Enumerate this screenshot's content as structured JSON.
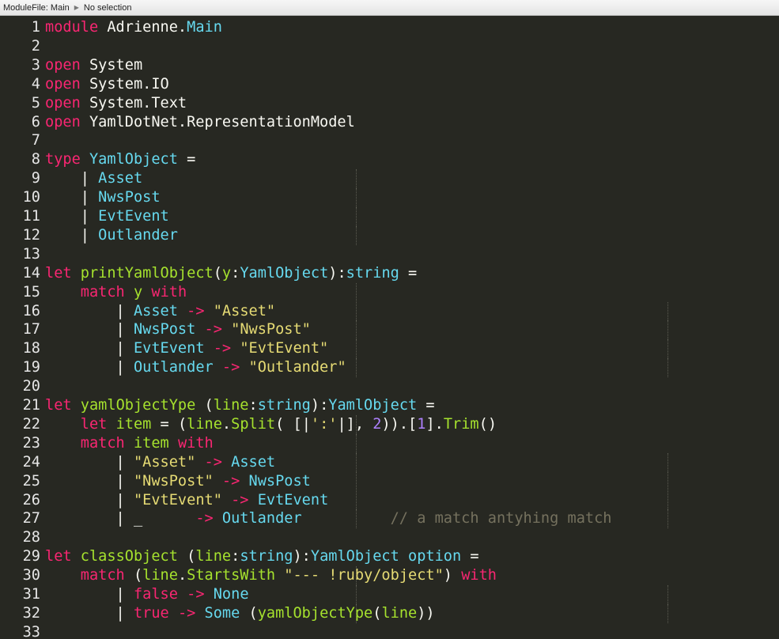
{
  "breadcrumb": {
    "module_file": "ModuleFile: Main",
    "separator": "▶",
    "selection": "No selection"
  },
  "theme": {
    "background": "#272822",
    "keyword": "#f92672",
    "type": "#66d9ef",
    "function": "#a6e22e",
    "string": "#e6db74",
    "number": "#ae81ff",
    "comment": "#75715e",
    "plain": "#f8f8f2"
  },
  "editor": {
    "lines": [
      {
        "num": "1",
        "tokens": [
          [
            "kw",
            "module"
          ],
          [
            "pl",
            " Adrienne."
          ],
          [
            "ty",
            "Main"
          ]
        ]
      },
      {
        "num": "2",
        "tokens": []
      },
      {
        "num": "3",
        "tokens": [
          [
            "kw",
            "open"
          ],
          [
            "pl",
            " System"
          ]
        ]
      },
      {
        "num": "4",
        "tokens": [
          [
            "kw",
            "open"
          ],
          [
            "pl",
            " System.IO"
          ]
        ]
      },
      {
        "num": "5",
        "tokens": [
          [
            "kw",
            "open"
          ],
          [
            "pl",
            " System.Text"
          ]
        ]
      },
      {
        "num": "6",
        "tokens": [
          [
            "kw",
            "open"
          ],
          [
            "pl",
            " YamlDotNet.RepresentationModel"
          ]
        ]
      },
      {
        "num": "7",
        "tokens": []
      },
      {
        "num": "8",
        "tokens": [
          [
            "kw",
            "type"
          ],
          [
            "pl",
            " "
          ],
          [
            "ty",
            "YamlObject"
          ],
          [
            "pl",
            " ="
          ]
        ]
      },
      {
        "num": "9",
        "tokens": [
          [
            "pl",
            "    | "
          ],
          [
            "ty",
            "Asset"
          ]
        ]
      },
      {
        "num": "10",
        "tokens": [
          [
            "pl",
            "    | "
          ],
          [
            "ty",
            "NwsPost"
          ]
        ]
      },
      {
        "num": "11",
        "tokens": [
          [
            "pl",
            "    | "
          ],
          [
            "ty",
            "EvtEvent"
          ]
        ]
      },
      {
        "num": "12",
        "tokens": [
          [
            "pl",
            "    | "
          ],
          [
            "ty",
            "Outlander"
          ]
        ]
      },
      {
        "num": "13",
        "tokens": []
      },
      {
        "num": "14",
        "tokens": [
          [
            "kw",
            "let"
          ],
          [
            "pl",
            " "
          ],
          [
            "fn",
            "printYamlObject"
          ],
          [
            "pl",
            "("
          ],
          [
            "fn",
            "y"
          ],
          [
            "pl",
            ":"
          ],
          [
            "ty",
            "YamlObject"
          ],
          [
            "pl",
            "):"
          ],
          [
            "ty",
            "string"
          ],
          [
            "pl",
            " ="
          ]
        ]
      },
      {
        "num": "15",
        "tokens": [
          [
            "pl",
            "    "
          ],
          [
            "kw",
            "match"
          ],
          [
            "pl",
            " "
          ],
          [
            "fn",
            "y"
          ],
          [
            "pl",
            " "
          ],
          [
            "kw",
            "with"
          ]
        ]
      },
      {
        "num": "16",
        "tokens": [
          [
            "pl",
            "        | "
          ],
          [
            "ty",
            "Asset"
          ],
          [
            "pl",
            " "
          ],
          [
            "kw",
            "->"
          ],
          [
            "pl",
            " "
          ],
          [
            "st",
            "\"Asset\""
          ]
        ]
      },
      {
        "num": "17",
        "tokens": [
          [
            "pl",
            "        | "
          ],
          [
            "ty",
            "NwsPost"
          ],
          [
            "pl",
            " "
          ],
          [
            "kw",
            "->"
          ],
          [
            "pl",
            " "
          ],
          [
            "st",
            "\"NwsPost\""
          ]
        ]
      },
      {
        "num": "18",
        "tokens": [
          [
            "pl",
            "        | "
          ],
          [
            "ty",
            "EvtEvent"
          ],
          [
            "pl",
            " "
          ],
          [
            "kw",
            "->"
          ],
          [
            "pl",
            " "
          ],
          [
            "st",
            "\"EvtEvent\""
          ]
        ]
      },
      {
        "num": "19",
        "tokens": [
          [
            "pl",
            "        | "
          ],
          [
            "ty",
            "Outlander"
          ],
          [
            "pl",
            " "
          ],
          [
            "kw",
            "->"
          ],
          [
            "pl",
            " "
          ],
          [
            "st",
            "\"Outlander\""
          ]
        ]
      },
      {
        "num": "20",
        "tokens": []
      },
      {
        "num": "21",
        "tokens": [
          [
            "kw",
            "let"
          ],
          [
            "pl",
            " "
          ],
          [
            "fn",
            "yamlObjectYpe"
          ],
          [
            "pl",
            " ("
          ],
          [
            "fn",
            "line"
          ],
          [
            "pl",
            ":"
          ],
          [
            "ty",
            "string"
          ],
          [
            "pl",
            "):"
          ],
          [
            "ty",
            "YamlObject"
          ],
          [
            "pl",
            " ="
          ]
        ]
      },
      {
        "num": "22",
        "tokens": [
          [
            "pl",
            "    "
          ],
          [
            "kw",
            "let"
          ],
          [
            "pl",
            " "
          ],
          [
            "fn",
            "item"
          ],
          [
            "pl",
            " = ("
          ],
          [
            "fn",
            "line"
          ],
          [
            "pl",
            "."
          ],
          [
            "fn",
            "Split"
          ],
          [
            "pl",
            "( [|"
          ],
          [
            "st",
            "':'"
          ],
          [
            "pl",
            "|], "
          ],
          [
            "nm",
            "2"
          ],
          [
            "pl",
            ")).["
          ],
          [
            "nm",
            "1"
          ],
          [
            "pl",
            "]."
          ],
          [
            "fn",
            "Trim"
          ],
          [
            "pl",
            "()"
          ]
        ]
      },
      {
        "num": "23",
        "tokens": [
          [
            "pl",
            "    "
          ],
          [
            "kw",
            "match"
          ],
          [
            "pl",
            " "
          ],
          [
            "fn",
            "item"
          ],
          [
            "pl",
            " "
          ],
          [
            "kw",
            "with"
          ]
        ]
      },
      {
        "num": "24",
        "tokens": [
          [
            "pl",
            "        | "
          ],
          [
            "st",
            "\"Asset\""
          ],
          [
            "pl",
            " "
          ],
          [
            "kw",
            "->"
          ],
          [
            "pl",
            " "
          ],
          [
            "ty",
            "Asset"
          ]
        ]
      },
      {
        "num": "25",
        "tokens": [
          [
            "pl",
            "        | "
          ],
          [
            "st",
            "\"NwsPost\""
          ],
          [
            "pl",
            " "
          ],
          [
            "kw",
            "->"
          ],
          [
            "pl",
            " "
          ],
          [
            "ty",
            "NwsPost"
          ]
        ]
      },
      {
        "num": "26",
        "tokens": [
          [
            "pl",
            "        | "
          ],
          [
            "st",
            "\"EvtEvent\""
          ],
          [
            "pl",
            " "
          ],
          [
            "kw",
            "->"
          ],
          [
            "pl",
            " "
          ],
          [
            "ty",
            "EvtEvent"
          ]
        ]
      },
      {
        "num": "27",
        "tokens": [
          [
            "pl",
            "        | _      "
          ],
          [
            "kw",
            "->"
          ],
          [
            "pl",
            " "
          ],
          [
            "ty",
            "Outlander"
          ],
          [
            "pl",
            "          "
          ],
          [
            "cm",
            "// a match antyhing match"
          ]
        ]
      },
      {
        "num": "28",
        "tokens": []
      },
      {
        "num": "29",
        "tokens": [
          [
            "kw",
            "let"
          ],
          [
            "pl",
            " "
          ],
          [
            "fn",
            "classObject"
          ],
          [
            "pl",
            " ("
          ],
          [
            "fn",
            "line"
          ],
          [
            "pl",
            ":"
          ],
          [
            "ty",
            "string"
          ],
          [
            "pl",
            "):"
          ],
          [
            "ty",
            "YamlObject"
          ],
          [
            "pl",
            " "
          ],
          [
            "ty",
            "option"
          ],
          [
            "pl",
            " ="
          ]
        ]
      },
      {
        "num": "30",
        "tokens": [
          [
            "pl",
            "    "
          ],
          [
            "kw",
            "match"
          ],
          [
            "pl",
            " ("
          ],
          [
            "fn",
            "line"
          ],
          [
            "pl",
            "."
          ],
          [
            "fn",
            "StartsWith"
          ],
          [
            "pl",
            " "
          ],
          [
            "st",
            "\"--- !ruby/object\""
          ],
          [
            "pl",
            ") "
          ],
          [
            "kw",
            "with"
          ]
        ]
      },
      {
        "num": "31",
        "tokens": [
          [
            "pl",
            "        | "
          ],
          [
            "kw",
            "false"
          ],
          [
            "pl",
            " "
          ],
          [
            "kw",
            "->"
          ],
          [
            "pl",
            " "
          ],
          [
            "ty",
            "None"
          ]
        ]
      },
      {
        "num": "32",
        "tokens": [
          [
            "pl",
            "        | "
          ],
          [
            "kw",
            "true"
          ],
          [
            "pl",
            " "
          ],
          [
            "kw",
            "->"
          ],
          [
            "pl",
            " "
          ],
          [
            "ty",
            "Some"
          ],
          [
            "pl",
            " ("
          ],
          [
            "fn",
            "yamlObjectYpe"
          ],
          [
            "pl",
            "("
          ],
          [
            "fn",
            "line"
          ],
          [
            "pl",
            "))"
          ]
        ]
      },
      {
        "num": "33",
        "tokens": []
      }
    ]
  }
}
